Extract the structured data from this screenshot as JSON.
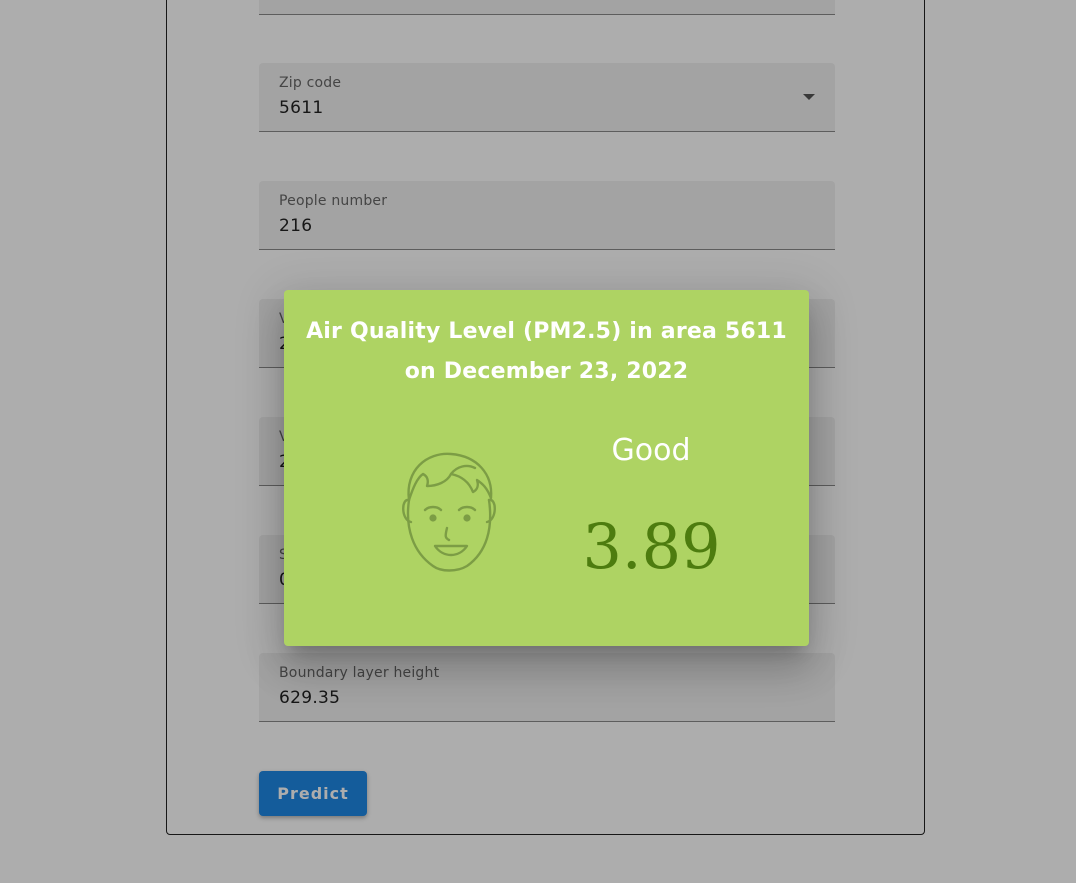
{
  "form": {
    "fields": [
      {
        "label": "",
        "value": ""
      },
      {
        "label": "Zip code",
        "value": "5611"
      },
      {
        "label": "People number",
        "value": "216"
      },
      {
        "label": "V",
        "value": "2"
      },
      {
        "label": "V",
        "value": "2"
      },
      {
        "label": "S",
        "value": "0"
      },
      {
        "label": "Boundary layer height",
        "value": "629.35"
      }
    ],
    "predict_label": "Predict"
  },
  "dialog": {
    "title_line1": "Air Quality Level (PM2.5) in area 5611",
    "title_line2": "on December 23, 2022",
    "level_label": "Good",
    "level_value": "3.89",
    "icon": "smiling-face-icon",
    "background_color": "#aed363",
    "value_color": "#4d7c0f"
  },
  "colors": {
    "primary": "#1e88e5",
    "overlay": "rgba(0,0,0,0.32)"
  }
}
